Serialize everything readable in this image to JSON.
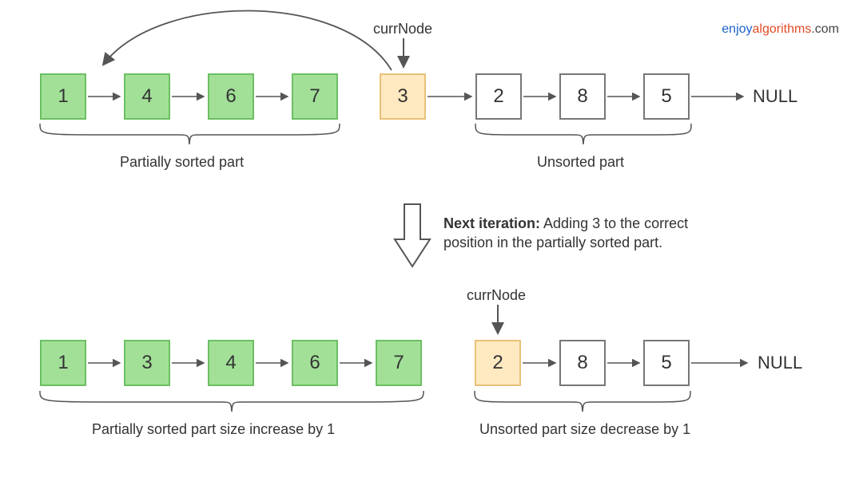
{
  "watermark": {
    "part1": "enjoy",
    "part2": "algorithms",
    "part3": ".com"
  },
  "row1": {
    "currNodeLabel": "currNode",
    "sorted": {
      "values": [
        "1",
        "4",
        "6",
        "7"
      ],
      "caption": "Partially sorted part"
    },
    "curr": "3",
    "unsorted": {
      "values": [
        "2",
        "8",
        "5"
      ],
      "caption": "Unsorted part"
    },
    "null": "NULL"
  },
  "transition": {
    "bold": "Next iteration:",
    "rest": " Adding 3 to the correct position in the partially sorted part."
  },
  "row2": {
    "currNodeLabel": "currNode",
    "sorted": {
      "values": [
        "1",
        "3",
        "4",
        "6",
        "7"
      ],
      "caption": "Partially sorted part size increase by 1"
    },
    "curr": "2",
    "unsorted": {
      "values": [
        "8",
        "5"
      ],
      "caption": "Unsorted part size decrease by 1"
    },
    "null": "NULL"
  }
}
